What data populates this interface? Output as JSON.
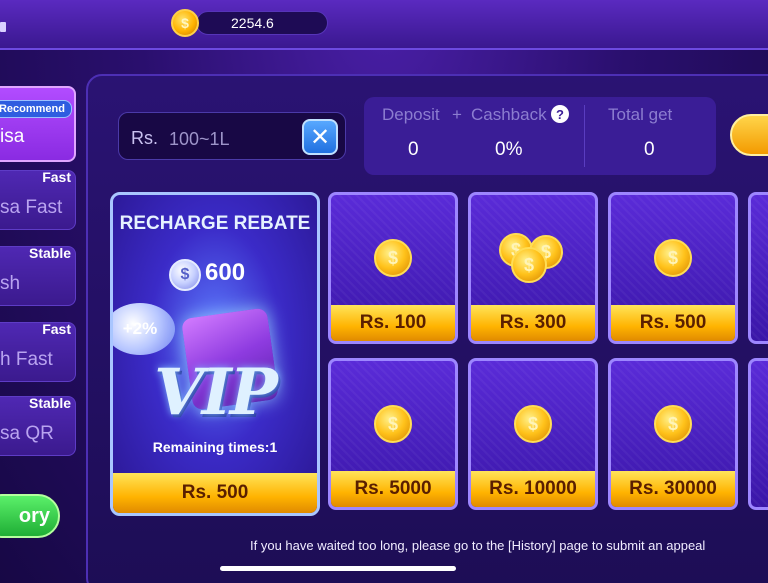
{
  "header": {
    "balance": "2254.6",
    "coin_icon": "coin-icon"
  },
  "sidebar": {
    "items": [
      {
        "tag": "Recommend",
        "label": "isa"
      },
      {
        "tag": "Fast",
        "label": "sa Fast"
      },
      {
        "tag": "Stable",
        "label": "sh"
      },
      {
        "tag": "Fast",
        "label": "h Fast"
      },
      {
        "tag": "Stable",
        "label": "sa QR"
      }
    ],
    "history_label": "ory"
  },
  "amount_input": {
    "prefix": "Rs.",
    "placeholder": "100~1L"
  },
  "summary": {
    "deposit_label": "Deposit",
    "plus": "+",
    "cashback_label": "Cashback",
    "help_symbol": "?",
    "total_label": "Total get",
    "deposit_value": "0",
    "cashback_value": "0%",
    "total_value": "0"
  },
  "vip_card": {
    "title": "RECHARGE REBATE",
    "amount": "600",
    "bonus": "+2%",
    "vip_text": "VIP",
    "remaining": "Remaining times:1",
    "price": "Rs. 500"
  },
  "amount_options": [
    {
      "price": "Rs. 100",
      "coins": "single"
    },
    {
      "price": "Rs. 300",
      "coins": "stack"
    },
    {
      "price": "Rs. 500",
      "coins": "single"
    },
    {
      "price": "Rs. 5000",
      "coins": "single"
    },
    {
      "price": "Rs. 10000",
      "coins": "single"
    },
    {
      "price": "Rs. 30000",
      "coins": "single"
    }
  ],
  "notice": "If you have waited too long, please go to the [History] page to submit an appeal",
  "colors": {
    "accent_gold": "#ffb300",
    "panel_purple": "#2a1373",
    "clear_blue": "#2070e0",
    "history_green": "#1fae35"
  }
}
